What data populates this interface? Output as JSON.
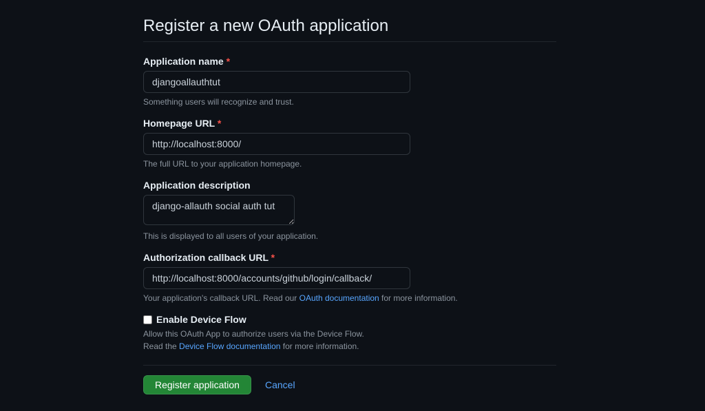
{
  "page": {
    "title": "Register a new OAuth application"
  },
  "fields": {
    "app_name": {
      "label": "Application name",
      "required": true,
      "value": "djangoallauthtut",
      "hint": "Something users will recognize and trust."
    },
    "homepage_url": {
      "label": "Homepage URL",
      "required": true,
      "value": "http://localhost:8000/",
      "hint": "The full URL to your application homepage."
    },
    "description": {
      "label": "Application description",
      "required": false,
      "value": "django-allauth social auth tut",
      "hint": "This is displayed to all users of your application."
    },
    "callback_url": {
      "label": "Authorization callback URL",
      "required": true,
      "value": "http://localhost:8000/accounts/github/login/callback/",
      "hint_prefix": "Your application's callback URL. Read our ",
      "hint_link": "OAuth documentation",
      "hint_suffix": " for more information."
    },
    "device_flow": {
      "label": "Enable Device Flow",
      "hint_line1": "Allow this OAuth App to authorize users via the Device Flow.",
      "hint_line2_prefix": "Read the ",
      "hint_line2_link": "Device Flow documentation",
      "hint_line2_suffix": " for more information."
    }
  },
  "buttons": {
    "submit": "Register application",
    "cancel": "Cancel"
  },
  "required_marker": "*"
}
